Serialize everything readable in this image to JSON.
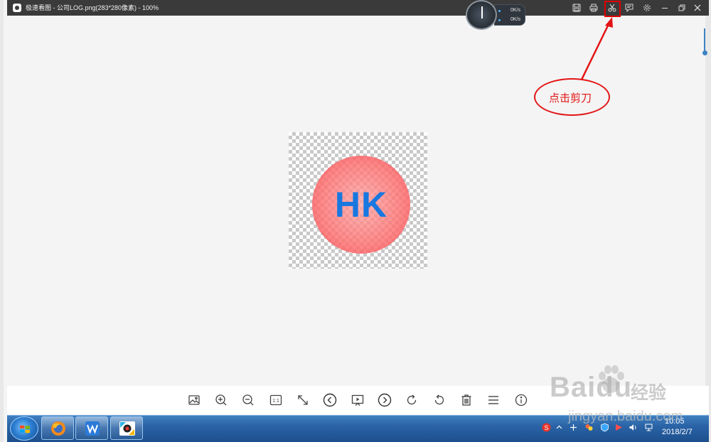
{
  "window": {
    "title": "极速看图 - 公司LOG.png(283*280像素) - 100%"
  },
  "speed_widget": {
    "up": "0K/s",
    "down": "0K/s"
  },
  "title_buttons": [
    {
      "name": "save-icon"
    },
    {
      "name": "print-icon"
    },
    {
      "name": "scissors-icon"
    },
    {
      "name": "comment-icon"
    },
    {
      "name": "gear-icon"
    },
    {
      "name": "minimize-icon"
    },
    {
      "name": "restore-icon"
    },
    {
      "name": "close-icon"
    }
  ],
  "image": {
    "logo_text": "HK"
  },
  "annotation": {
    "text": "点击剪刀",
    "color": "#e31414"
  },
  "bottom_toolbar": [
    {
      "name": "image-icon"
    },
    {
      "name": "zoom-in-icon"
    },
    {
      "name": "zoom-out-icon"
    },
    {
      "name": "actual-size-icon",
      "label": "1:1"
    },
    {
      "name": "fullscreen-icon"
    },
    {
      "name": "previous-icon"
    },
    {
      "name": "slideshow-icon"
    },
    {
      "name": "next-icon"
    },
    {
      "name": "rotate-right-icon"
    },
    {
      "name": "rotate-left-icon"
    },
    {
      "name": "delete-icon"
    },
    {
      "name": "menu-icon"
    },
    {
      "name": "info-icon"
    }
  ],
  "taskbar": {
    "apps": [
      "firefox-icon",
      "wps-icon",
      "image-viewer-icon"
    ],
    "clock_time": "10:05",
    "clock_date": "2018/2/7"
  },
  "watermark": {
    "brand": "Baidu",
    "brand_cn": "经验",
    "url": "jingyan.baidu.com"
  },
  "colors": {
    "titlebar": "#3a3a3a",
    "accent_red": "#e31414",
    "logo_blue": "#1878e0",
    "taskbar": "#2a63a6"
  }
}
